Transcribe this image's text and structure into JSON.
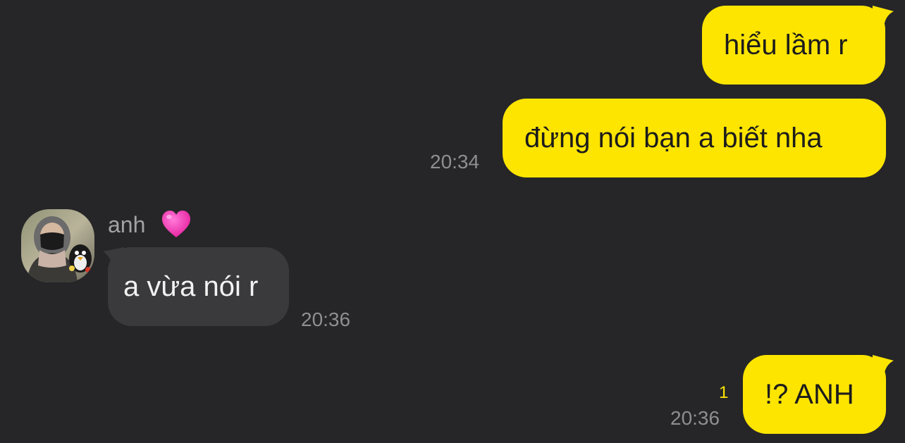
{
  "colors": {
    "background": "#262628",
    "outgoing_bubble": "#FEE500",
    "incoming_bubble": "#3a3a3c",
    "timestamp": "#8e8e93",
    "unread_count": "#FEE500"
  },
  "messages": [
    {
      "direction": "outgoing",
      "text": "hiểu lầm r"
    },
    {
      "direction": "outgoing",
      "text": "đừng nói bạn a biết nha",
      "time": "20:34"
    },
    {
      "direction": "incoming",
      "sender": "anh",
      "sender_emoji": "pink-heart-icon",
      "text": "a vừa nói r",
      "time": "20:36"
    },
    {
      "direction": "outgoing",
      "text": "!? ANH",
      "time": "20:36",
      "unread": "1"
    }
  ]
}
